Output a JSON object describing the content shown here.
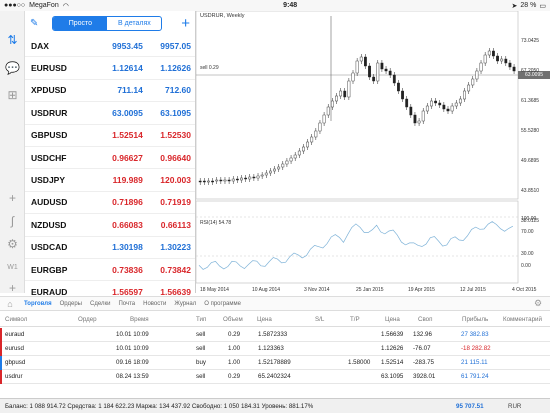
{
  "status": {
    "carrier": "MegaFon",
    "time": "9:48",
    "battery": "28 %"
  },
  "quotes": {
    "toggle": {
      "simple": "Просто",
      "details": "В деталях"
    },
    "rows": [
      {
        "symbol": "DAX",
        "bid": "9953.45",
        "ask": "9957.05",
        "dir": "up"
      },
      {
        "symbol": "EURUSD",
        "bid": "1.12614",
        "ask": "1.12626",
        "dir": "up"
      },
      {
        "symbol": "XPDUSD",
        "bid": "711.14",
        "ask": "712.60",
        "dir": "up"
      },
      {
        "symbol": "USDRUR",
        "bid": "63.0095",
        "ask": "63.1095",
        "dir": "up"
      },
      {
        "symbol": "GBPUSD",
        "bid": "1.52514",
        "ask": "1.52530",
        "dir": "down"
      },
      {
        "symbol": "USDCHF",
        "bid": "0.96627",
        "ask": "0.96640",
        "dir": "down"
      },
      {
        "symbol": "USDJPY",
        "bid": "119.989",
        "ask": "120.003",
        "dir": "down"
      },
      {
        "symbol": "AUDUSD",
        "bid": "0.71896",
        "ask": "0.71919",
        "dir": "down"
      },
      {
        "symbol": "NZDUSD",
        "bid": "0.66083",
        "ask": "0.66113",
        "dir": "down"
      },
      {
        "symbol": "USDCAD",
        "bid": "1.30198",
        "ask": "1.30223",
        "dir": "up"
      },
      {
        "symbol": "EURGBP",
        "bid": "0.73836",
        "ask": "0.73842",
        "dir": "down"
      },
      {
        "symbol": "EURAUD",
        "bid": "1.56597",
        "ask": "1.56639",
        "dir": "down"
      }
    ]
  },
  "chart": {
    "title": "USDRUR, Weekly",
    "sell_label": "sell 0.29",
    "rsi_label": "RSI(14) 54.78",
    "price_box": "63.0095",
    "y_labels": [
      "73.0425",
      "67.2050",
      "61.3685",
      "55.5280",
      "49.6895",
      "43.8510",
      "38.0125"
    ],
    "rsi_y_labels": [
      "100.00",
      "70.00",
      "30.00",
      "0.00"
    ],
    "x_labels": [
      "18 May 2014",
      "10 Aug 2014",
      "3 Nov 2014",
      "25 Jan 2015",
      "19 Apr 2015",
      "12 Jul 2015",
      "4 Oct 2015"
    ]
  },
  "tabs": {
    "items": [
      "Торговля",
      "Ордеры",
      "Сделки",
      "Почта",
      "Новости",
      "Журнал",
      "О программе"
    ],
    "active": 0
  },
  "table": {
    "headers": [
      "Символ",
      "Ордер",
      "Время",
      "Тип",
      "Объем",
      "Цена",
      "S/L",
      "T/P",
      "Цена",
      "Своп",
      "Прибыль",
      "Комментарий"
    ],
    "rows": [
      {
        "symbol": "euraud",
        "time": "10.01 10:09",
        "type": "sell",
        "volume": "0.29",
        "price": "1.5872333",
        "sl": "",
        "tp": "",
        "cur": "1.56639",
        "swap": "132.96",
        "profit": "27 382.83",
        "dir": "up"
      },
      {
        "symbol": "eurusd",
        "time": "10.01 10:09",
        "type": "sell",
        "volume": "1.00",
        "price": "1.123363",
        "sl": "",
        "tp": "",
        "cur": "1.12626",
        "swap": "-76.07",
        "profit": "-18 282.82",
        "dir": "down"
      },
      {
        "symbol": "gbpusd",
        "time": "09.16 18:09",
        "type": "buy",
        "volume": "1.00",
        "price": "1.52178889",
        "sl": "",
        "tp": "1.58000",
        "cur": "1.52514",
        "swap": "-283.75",
        "profit": "21 115.11",
        "dir": "up"
      },
      {
        "symbol": "usdrur",
        "time": "08.24 13:59",
        "type": "sell",
        "volume": "0.29",
        "price": "65.2402324",
        "sl": "",
        "tp": "",
        "cur": "63.1095",
        "swap": "3928.01",
        "profit": "61 791.24",
        "dir": "up"
      }
    ]
  },
  "footer": {
    "balance_line": "Баланс: 1 088 914.72 Средства: 1 184 622.23 Маржа: 134 437.92 Свободно: 1 050 184.31 Уровень: 881.17%",
    "total": "95 707.51",
    "currency": "RUR"
  },
  "colors": {
    "accent": "#1f7ce8",
    "up": "#1f6fd6",
    "down": "#d9262a"
  }
}
